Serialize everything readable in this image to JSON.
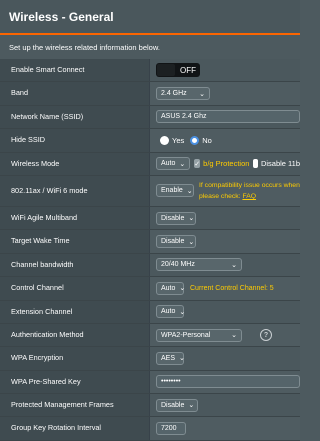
{
  "header": {
    "title": "Wireless - General"
  },
  "description": "Set up the wireless related information below.",
  "rows": {
    "smart_connect": {
      "label": "Enable Smart Connect",
      "toggle": "OFF"
    },
    "band": {
      "label": "Band",
      "value": "2.4 GHz"
    },
    "ssid": {
      "label": "Network Name (SSID)",
      "value": "ASUS 2.4 Ghz"
    },
    "hide_ssid": {
      "label": "Hide SSID",
      "yes": "Yes",
      "no": "No",
      "selected": "No"
    },
    "wireless_mode": {
      "label": "Wireless Mode",
      "value": "Auto",
      "bg_protection": "b/g Protection",
      "disable_11b": "Disable 11b"
    },
    "wifi6": {
      "label": "802.11ax / WiFi 6 mode",
      "value": "Enable",
      "note_line1": "If compatibility issue occurs when",
      "note_line2": "please check:",
      "faq": "FAQ"
    },
    "agile_multiband": {
      "label": "WiFi Agile Multiband",
      "value": "Disable"
    },
    "target_wake": {
      "label": "Target Wake Time",
      "value": "Disable"
    },
    "bandwidth": {
      "label": "Channel bandwidth",
      "value": "20/40 MHz"
    },
    "control_channel": {
      "label": "Control Channel",
      "value": "Auto",
      "current": "Current Control Channel: 5"
    },
    "extension_channel": {
      "label": "Extension Channel",
      "value": "Auto"
    },
    "auth_method": {
      "label": "Authentication Method",
      "value": "WPA2-Personal",
      "help": "?"
    },
    "wpa_encryption": {
      "label": "WPA Encryption",
      "value": "AES"
    },
    "psk": {
      "label": "WPA Pre-Shared Key",
      "value": "••••••••"
    },
    "pmf": {
      "label": "Protected Management Frames",
      "value": "Disable"
    },
    "gk_rotation": {
      "label": "Group Key Rotation Interval",
      "value": "7200"
    }
  }
}
